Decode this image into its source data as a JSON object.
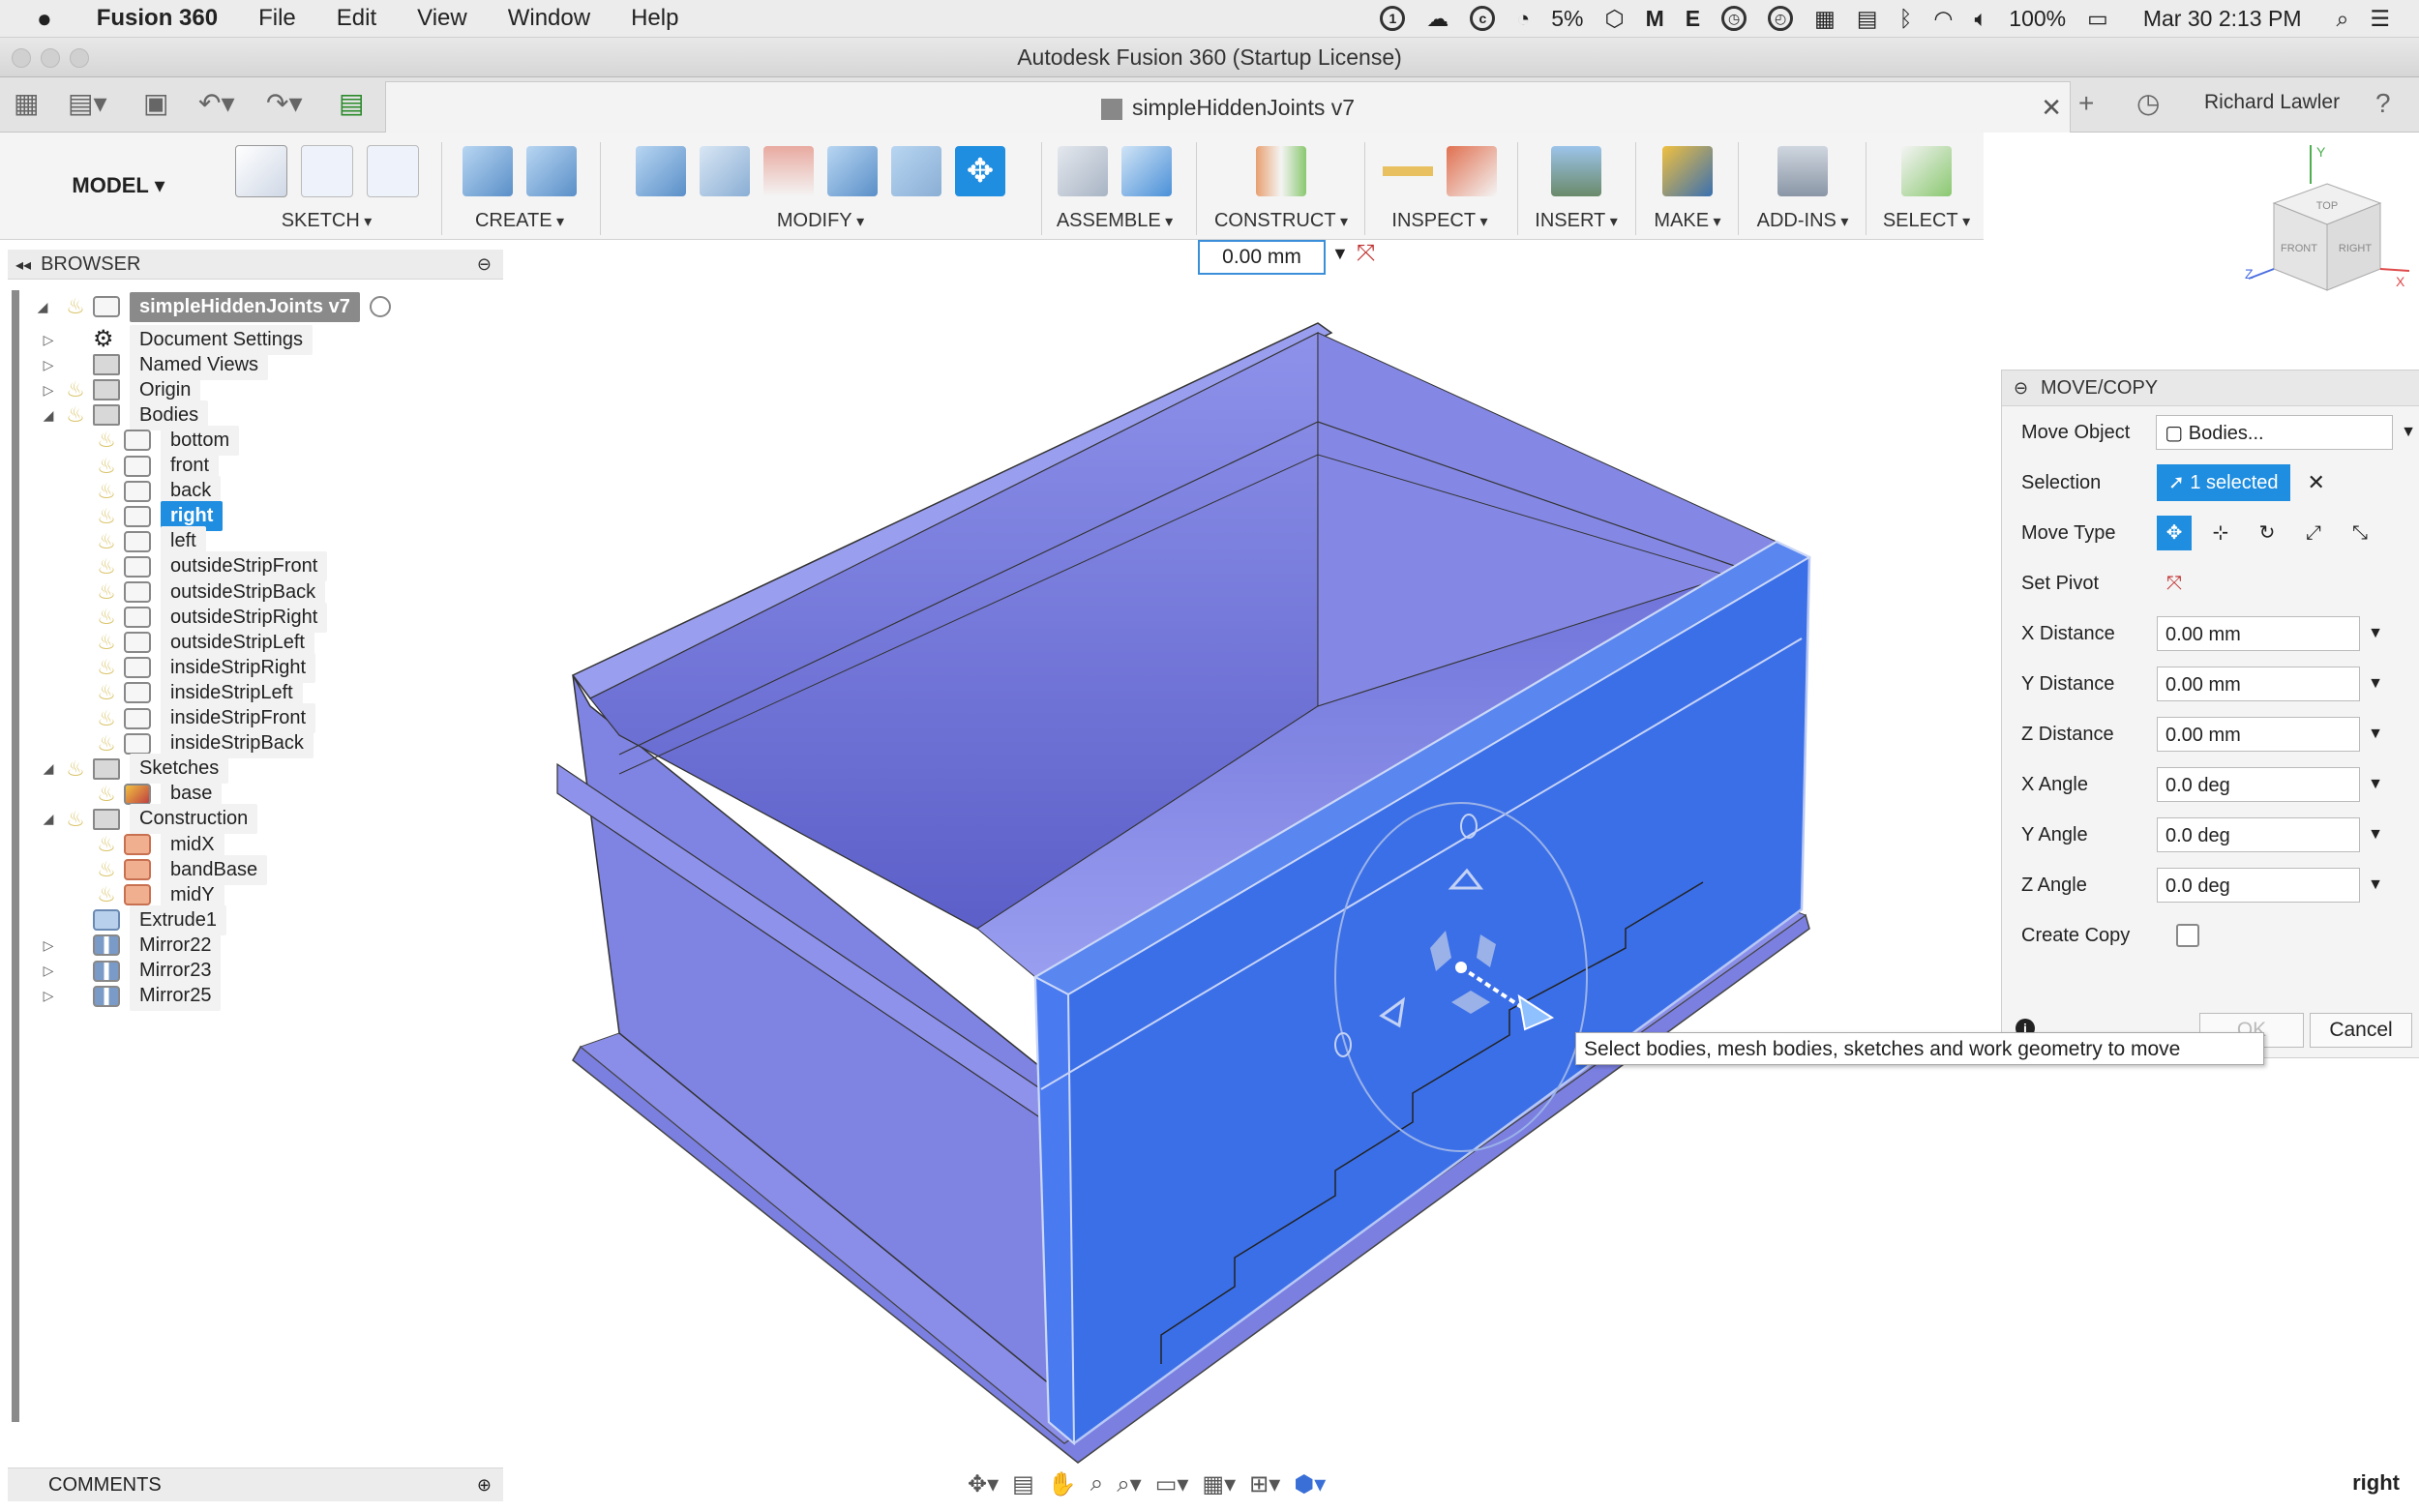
{
  "menubar": {
    "app": "Fusion 360",
    "items": [
      "File",
      "Edit",
      "View",
      "Window",
      "Help"
    ],
    "cpu": "5%",
    "battery": "100%",
    "datetime": "Mar 30  2:13 PM"
  },
  "window": {
    "title": "Autodesk Fusion 360 (Startup License)"
  },
  "tabbar": {
    "doc_tab": "simpleHiddenJoints v7",
    "user": "Richard Lawler"
  },
  "toolbar": {
    "mode": "MODEL",
    "groups": [
      "SKETCH",
      "CREATE",
      "MODIFY",
      "ASSEMBLE",
      "CONSTRUCT",
      "INSPECT",
      "INSERT",
      "MAKE",
      "ADD-INS",
      "SELECT"
    ],
    "distance_value": "0.00 mm"
  },
  "browser": {
    "title": "BROWSER",
    "root": "simpleHiddenJoints v7",
    "items": [
      {
        "label": "Document Settings"
      },
      {
        "label": "Named Views"
      },
      {
        "label": "Origin"
      },
      {
        "label": "Bodies"
      },
      {
        "label": "bottom"
      },
      {
        "label": "front"
      },
      {
        "label": "back"
      },
      {
        "label": "right"
      },
      {
        "label": "left"
      },
      {
        "label": "outsideStripFront"
      },
      {
        "label": "outsideStripBack"
      },
      {
        "label": "outsideStripRight"
      },
      {
        "label": "outsideStripLeft"
      },
      {
        "label": "insideStripRight"
      },
      {
        "label": "insideStripLeft"
      },
      {
        "label": "insideStripFront"
      },
      {
        "label": "insideStripBack"
      },
      {
        "label": "Sketches"
      },
      {
        "label": "base"
      },
      {
        "label": "Construction"
      },
      {
        "label": "midX"
      },
      {
        "label": "bandBase"
      },
      {
        "label": "midY"
      },
      {
        "label": "Extrude1"
      },
      {
        "label": "Mirror22"
      },
      {
        "label": "Mirror23"
      },
      {
        "label": "Mirror25"
      }
    ]
  },
  "comments": {
    "title": "COMMENTS"
  },
  "move_copy": {
    "title": "MOVE/COPY",
    "move_object_label": "Move Object",
    "move_object_value": "Bodies...",
    "selection_label": "Selection",
    "selection_value": "1 selected",
    "move_type_label": "Move Type",
    "set_pivot_label": "Set Pivot",
    "x_distance_label": "X Distance",
    "x_distance_value": "0.00 mm",
    "y_distance_label": "Y Distance",
    "y_distance_value": "0.00 mm",
    "z_distance_label": "Z Distance",
    "z_distance_value": "0.00 mm",
    "x_angle_label": "X Angle",
    "x_angle_value": "0.0 deg",
    "y_angle_label": "Y Angle",
    "y_angle_value": "0.0 deg",
    "z_angle_label": "Z Angle",
    "z_angle_value": "0.0 deg",
    "create_copy_label": "Create Copy",
    "ok_label": "OK",
    "cancel_label": "Cancel"
  },
  "tooltip": {
    "text": "Select bodies, mesh bodies, sketches and work geometry to move"
  },
  "viewcube": {
    "top": "TOP",
    "front": "FRONT",
    "right": "RIGHT",
    "x": "X",
    "y": "Y",
    "z": "Z"
  },
  "viewport": {
    "view_name": "right"
  },
  "colors": {
    "accent": "#1f8ee0",
    "body": "#7b7fe0",
    "selected_body": "#3b6fe8"
  }
}
